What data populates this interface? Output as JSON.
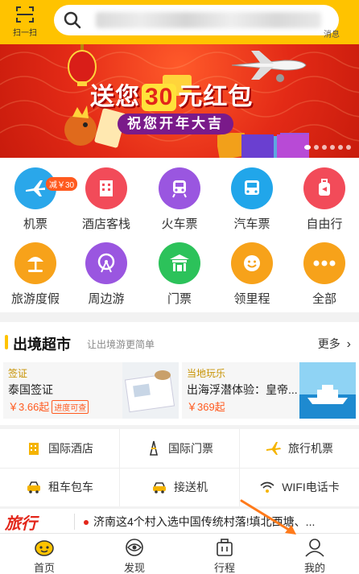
{
  "topbar": {
    "scan_label": "扫一扫",
    "search_placeholder": "",
    "message_label": "消息"
  },
  "banner": {
    "title_pre": "送您",
    "title_highlight": "30",
    "title_post": "元红包",
    "subtitle": "祝您开年大吉",
    "slide_count": 6,
    "active_slide": 1
  },
  "categories": [
    {
      "label": "机票",
      "icon": "airplane-icon",
      "color": "#2aa7ea",
      "tag": "减￥30"
    },
    {
      "label": "酒店客栈",
      "icon": "hotel-building-icon",
      "color": "#f24b59"
    },
    {
      "label": "火车票",
      "icon": "train-icon",
      "color": "#9a56e0"
    },
    {
      "label": "汽车票",
      "icon": "bus-icon",
      "color": "#21a6ea"
    },
    {
      "label": "自由行",
      "icon": "suitcase-icon",
      "color": "#f24b59"
    },
    {
      "label": "旅游度假",
      "icon": "palm-tree-icon",
      "color": "#f7a21a"
    },
    {
      "label": "周边游",
      "icon": "ferris-wheel-icon",
      "color": "#9a56e0"
    },
    {
      "label": "门票",
      "icon": "gate-pavilion-icon",
      "color": "#2cc25a"
    },
    {
      "label": "领里程",
      "icon": "smiley-icon",
      "color": "#f7a21a"
    },
    {
      "label": "全部",
      "icon": "more-dots-icon",
      "color": "#f7a21a"
    }
  ],
  "outbound": {
    "title": "出境超市",
    "subtitle": "让出境游更简单",
    "more_label": "更多",
    "cards": [
      {
        "category": "签证",
        "name": "泰国签证",
        "price": "￥3.66起",
        "badge": "进度可查",
        "image": "passport-image"
      },
      {
        "category": "当地玩乐",
        "name": "出海浮潜体验：皇帝...",
        "price": "￥369起",
        "image": "yacht-image"
      }
    ]
  },
  "quick_links": [
    {
      "label": "国际酒店",
      "icon": "hotel-icon"
    },
    {
      "label": "国际门票",
      "icon": "tower-icon"
    },
    {
      "label": "旅行机票",
      "icon": "plane-icon"
    },
    {
      "label": "租车包车",
      "icon": "taxi-icon"
    },
    {
      "label": "接送机",
      "icon": "car-pickup-icon"
    },
    {
      "label": "WIFI电话卡",
      "icon": "wifi-icon"
    }
  ],
  "news": {
    "logo": "旅行",
    "headline": "济南这4个村入选中国传统村落!填北西塘、..."
  },
  "tabbar": [
    {
      "label": "首页",
      "icon": "home-icon"
    },
    {
      "label": "发现",
      "icon": "discover-eye-icon"
    },
    {
      "label": "行程",
      "icon": "itinerary-bag-icon"
    },
    {
      "label": "我的",
      "icon": "user-icon"
    }
  ]
}
